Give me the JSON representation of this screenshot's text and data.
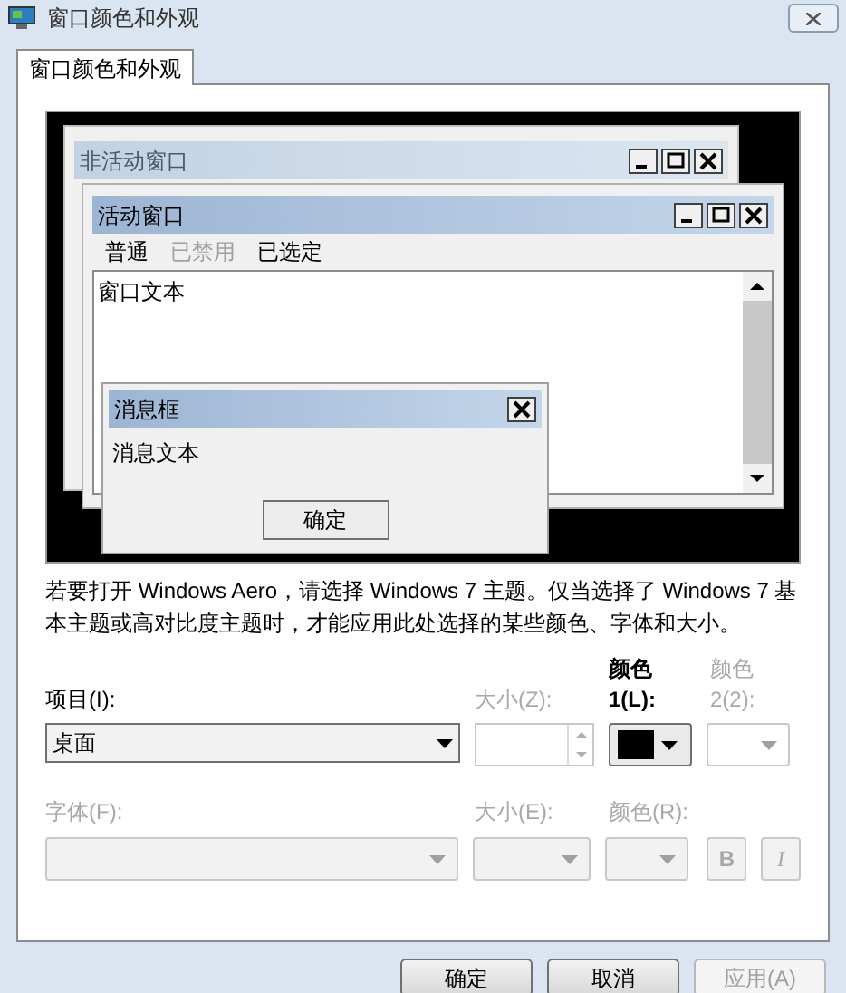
{
  "window": {
    "title": "窗口颜色和外观"
  },
  "tabs": [
    {
      "label": "窗口颜色和外观",
      "selected": true
    }
  ],
  "preview": {
    "inactive_window": {
      "title": "非活动窗口"
    },
    "active_window": {
      "title": "活动窗口",
      "menu": [
        {
          "label": "普通",
          "disabled": false
        },
        {
          "label": "已禁用",
          "disabled": true
        },
        {
          "label": "已选定",
          "disabled": false
        }
      ],
      "text": "窗口文本"
    },
    "message_box": {
      "title": "消息框",
      "text": "消息文本",
      "button": "确定"
    }
  },
  "description": "若要打开 Windows Aero，请选择 Windows 7 主题。仅当选择了 Windows 7 基本主题或高对比度主题时，才能应用此处选择的某些颜色、字体和大小。",
  "item": {
    "label": "项目(I):",
    "value": "桌面",
    "disabled": false
  },
  "item_size": {
    "label": "大小(Z):",
    "disabled": true
  },
  "color1": {
    "label": "颜色 1(L):",
    "color": "#000000",
    "disabled": false
  },
  "color2": {
    "label": "颜色 2(2):",
    "disabled": true
  },
  "font": {
    "label": "字体(F):",
    "disabled": true
  },
  "font_size": {
    "label": "大小(E):",
    "disabled": true
  },
  "font_color": {
    "label": "颜色(R):",
    "disabled": true
  },
  "bold": {
    "label": "B",
    "disabled": true
  },
  "italic": {
    "label": "I",
    "disabled": true
  },
  "buttons": [
    {
      "label": "确定",
      "disabled": false
    },
    {
      "label": "取消",
      "disabled": false
    },
    {
      "label": "应用(A)",
      "disabled": true
    }
  ]
}
